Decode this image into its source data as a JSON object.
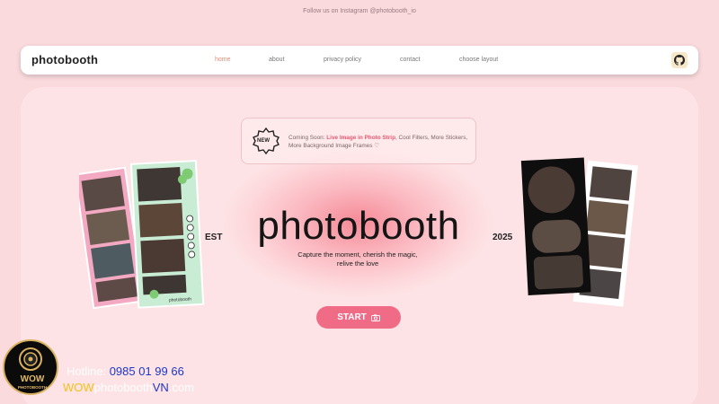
{
  "topbar": {
    "text": "Follow us on Instagram @photobooth_io"
  },
  "nav": {
    "brand": "photobooth",
    "links": [
      "home",
      "about",
      "privacy policy",
      "contact",
      "choose layout"
    ],
    "active": "home"
  },
  "notice": {
    "badge": "NEW",
    "prefix": "Coming Soon: ",
    "highlight": "Live Image in Photo Strip",
    "rest": ", Cool Filters, More Stickers, More Background Image Frames ♡"
  },
  "hero": {
    "title": "photobooth",
    "est": "EST",
    "year": "2025",
    "tagline_1": "Capture the moment, cherish the magic,",
    "tagline_2": "relive the love",
    "start_label": "START"
  },
  "left_strip": {
    "footer": "photobooth"
  },
  "promo": {
    "logo_top": "WOW",
    "logo_bottom": "PHOTOBOOTH",
    "hotline_label": "Hotline: ",
    "hotline_number": "0985 01 99 66",
    "site_wow": "WOW",
    "site_mid": "photobooth",
    "site_vn": "VN",
    "site_tld": ".com"
  },
  "colors": {
    "accent": "#ef6b86",
    "page_bg": "#fadadd",
    "active_nav": "#e8886f",
    "highlight": "#e45a72"
  }
}
